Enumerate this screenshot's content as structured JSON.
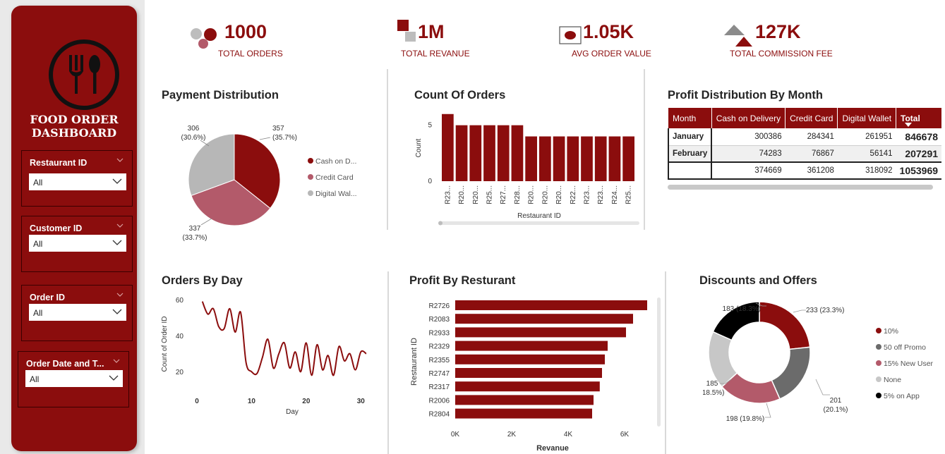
{
  "sidebar": {
    "title_line1": "FOOD ORDER",
    "title_line2": "DASHBOARD",
    "slicers": [
      {
        "label": "Restaurant ID",
        "value": "All"
      },
      {
        "label": "Customer ID",
        "value": "All"
      },
      {
        "label": "Order ID",
        "value": "All"
      },
      {
        "label": "Order Date and T...",
        "value": "All"
      }
    ]
  },
  "kpis": [
    {
      "value": "1000",
      "label": "TOTAL ORDERS"
    },
    {
      "value": "1M",
      "label": "TOTAL REVANUE"
    },
    {
      "value": "1.05K",
      "label": "AVG ORDER VALUE"
    },
    {
      "value": "127K",
      "label": "TOTAL COMMISSION FEE"
    }
  ],
  "titles": {
    "payment": "Payment Distribution",
    "count_orders": "Count Of Orders",
    "profit_month": "Profit Distribution By Month",
    "orders_day": "Orders By Day",
    "profit_rest": "Profit By Resturant",
    "discounts": "Discounts and Offers"
  },
  "colors": {
    "accent": "#8b0d0d",
    "pink": "#b35a6a",
    "gray": "#b7b7b7",
    "dark_gray": "#6b6b6b",
    "black": "#000000"
  },
  "chart_data": [
    {
      "id": "payment",
      "type": "pie",
      "slices": [
        {
          "name": "Cash on D...",
          "value": 357,
          "label1": "357",
          "label2": "(35.7%)",
          "color": "#8b0d0d"
        },
        {
          "name": "Credit Card",
          "value": 337,
          "label1": "337",
          "label2": "(33.7%)",
          "color": "#b35a6a"
        },
        {
          "name": "Digital Wal...",
          "value": 306,
          "label1": "306",
          "label2": "(30.6%)",
          "color": "#b7b7b7"
        }
      ]
    },
    {
      "id": "count_orders",
      "type": "bar",
      "categories": [
        "R23...",
        "R20...",
        "R20...",
        "R25...",
        "R27...",
        "R28...",
        "R20...",
        "R20...",
        "R20...",
        "R22...",
        "R23...",
        "R23...",
        "R24...",
        "R25..."
      ],
      "values": [
        6,
        5,
        5,
        5,
        5,
        5,
        4,
        4,
        4,
        4,
        4,
        4,
        4,
        4
      ],
      "xlabel": "Restaurant ID",
      "ylabel": "Count",
      "yticks": [
        "0",
        "5"
      ],
      "ylim": [
        0,
        6.3
      ]
    },
    {
      "id": "orders_day",
      "type": "line",
      "x": [
        1,
        2,
        3,
        4,
        5,
        6,
        7,
        8,
        9,
        10,
        11,
        12,
        13,
        14,
        15,
        16,
        17,
        18,
        19,
        20,
        21,
        22,
        23,
        24,
        25,
        26,
        27,
        28,
        29,
        30,
        31
      ],
      "values": [
        59,
        52,
        55,
        45,
        44,
        55,
        42,
        53,
        25,
        20,
        19,
        28,
        38,
        22,
        30,
        36,
        22,
        31,
        20,
        36,
        18,
        35,
        21,
        29,
        18,
        34,
        26,
        30,
        21,
        31,
        30
      ],
      "xlabel": "Day",
      "ylabel": "Count of Order ID",
      "xticks": [
        "0",
        "10",
        "20",
        "30"
      ],
      "yticks": [
        "20",
        "40",
        "60"
      ],
      "xlim": [
        0,
        31
      ],
      "ylim": [
        15,
        62
      ]
    },
    {
      "id": "profit_rest",
      "type": "bar",
      "orientation": "horizontal",
      "categories": [
        "R2726",
        "R2083",
        "R2933",
        "R2329",
        "R2355",
        "R2747",
        "R2317",
        "R2006",
        "R2804"
      ],
      "values": [
        6800,
        6300,
        6050,
        5400,
        5300,
        5200,
        5120,
        4900,
        4850
      ],
      "xlabel": "Revanue",
      "ylabel": "Restaurant ID",
      "xticks": [
        "0K",
        "2K",
        "4K",
        "6K"
      ],
      "xlim": [
        0,
        7000
      ]
    },
    {
      "id": "discounts",
      "type": "pie",
      "donut": true,
      "slices": [
        {
          "name": "10%",
          "value": 233,
          "label": "233 (23.3%)",
          "color": "#8b0d0d"
        },
        {
          "name": "50 off Promo",
          "value": 201,
          "label": "201 (20.1%)",
          "label1": "201",
          "label2": "(20.1%)",
          "color": "#6b6b6b"
        },
        {
          "name": "15% New User",
          "value": 198,
          "label": "198 (19.8%)",
          "color": "#b35a6a"
        },
        {
          "name": "None",
          "value": 185,
          "label": "185 (18.5%)",
          "label1": "185",
          "label2": "(18.5%)",
          "color": "#c7c7c7"
        },
        {
          "name": "5% on App",
          "value": 183,
          "label": "183 (18.3%)",
          "color": "#000000"
        }
      ]
    },
    {
      "id": "profit_month",
      "type": "table",
      "headers": [
        "Month",
        "Cash on Delivery",
        "Credit Card",
        "Digital Wallet",
        "Total"
      ],
      "rows": [
        [
          "January",
          "300386",
          "284341",
          "261951",
          "846678"
        ],
        [
          "February",
          "74283",
          "76867",
          "56141",
          "207291"
        ],
        [
          "",
          "374669",
          "361208",
          "318092",
          "1053969"
        ]
      ]
    }
  ]
}
